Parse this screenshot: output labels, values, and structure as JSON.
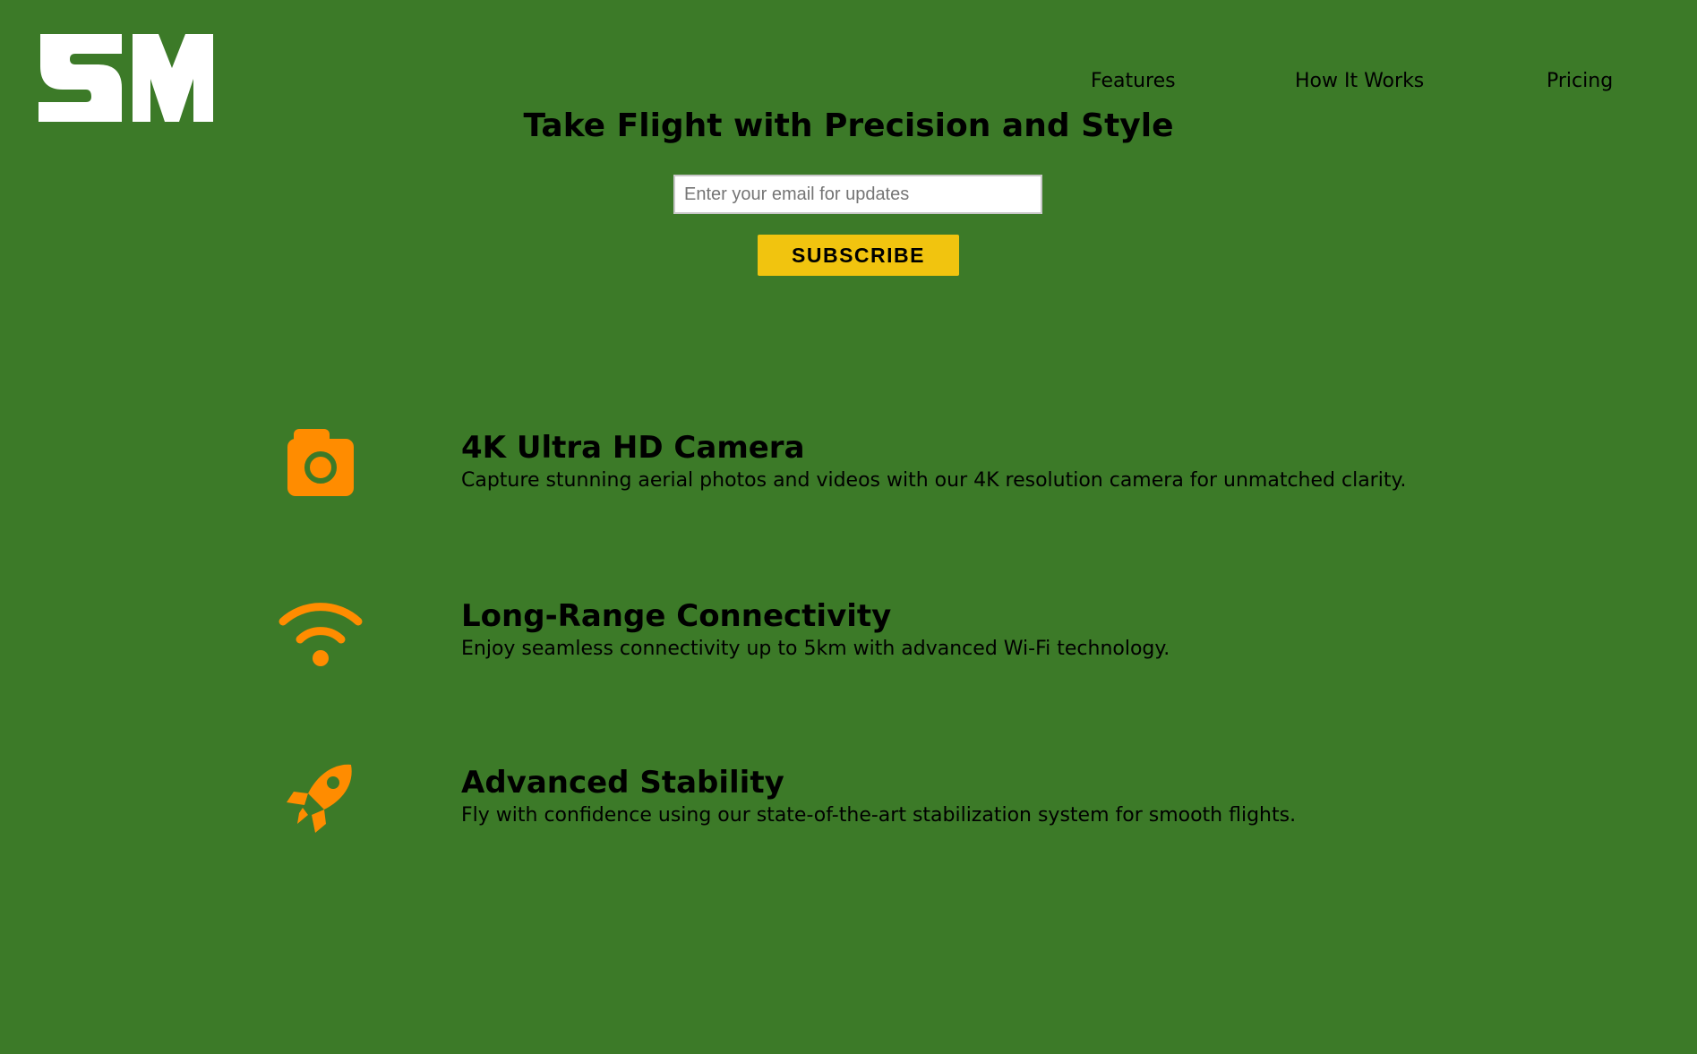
{
  "brand": {
    "logo_text": "SM",
    "logo_color": "#ffffff"
  },
  "nav": {
    "items": [
      {
        "label": "Features"
      },
      {
        "label": "How It Works"
      },
      {
        "label": "Pricing"
      }
    ]
  },
  "hero": {
    "title": "Take Flight with Precision and Style",
    "email_placeholder": "Enter your email for updates",
    "subscribe_label": "Subscribe"
  },
  "features": [
    {
      "icon": "camera-icon",
      "title": "4K Ultra HD Camera",
      "text": "Capture stunning aerial photos and videos with our 4K resolution camera for unmatched clarity."
    },
    {
      "icon": "wifi-icon",
      "title": "Long-Range Connectivity",
      "text": "Enjoy seamless connectivity up to 5km with advanced Wi-Fi technology."
    },
    {
      "icon": "rocket-icon",
      "title": "Advanced Stability",
      "text": "Fly with confidence using our state-of-the-art stabilization system for smooth flights."
    }
  ],
  "colors": {
    "background": "#3c7a28",
    "accent": "#f1c40f",
    "icon": "#ff8c00",
    "text": "#000000"
  }
}
